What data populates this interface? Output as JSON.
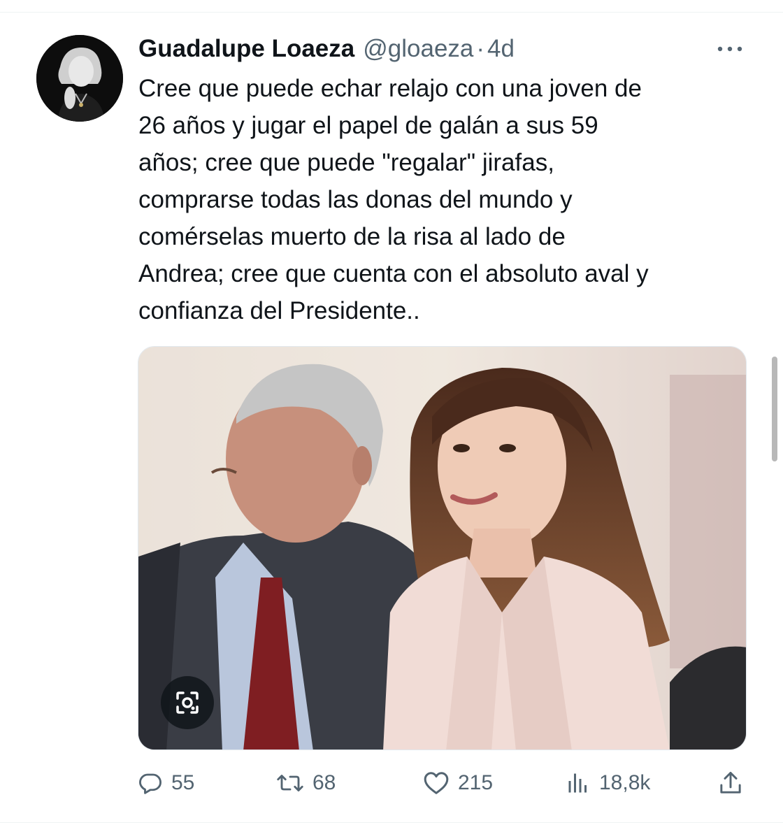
{
  "tweet": {
    "author_name": "Guadalupe Loaeza",
    "handle": "@gloaeza",
    "separator": "·",
    "time": "4d",
    "text_lines": [
      "Cree que puede echar relajo con una joven de",
      "26 años y jugar el papel de galán a sus 59",
      "años; cree que puede \"regalar\" jirafas,",
      "comprarse todas las donas del mundo y",
      "comérselas muerto de la risa al lado de",
      "Andrea; cree que cuenta con el absoluto aval y",
      "confianza del Presidente.."
    ]
  },
  "actions": {
    "replies": "55",
    "retweets": "68",
    "likes": "215",
    "views": "18,8k"
  },
  "icons": {
    "more": "more-horizontal-icon",
    "lens": "lens-icon",
    "reply": "reply-icon",
    "retweet": "retweet-icon",
    "like": "heart-icon",
    "views": "views-icon",
    "share": "share-icon"
  },
  "colors": {
    "text": "#0f1419",
    "secondary": "#536471",
    "divider": "#eff3f4"
  }
}
